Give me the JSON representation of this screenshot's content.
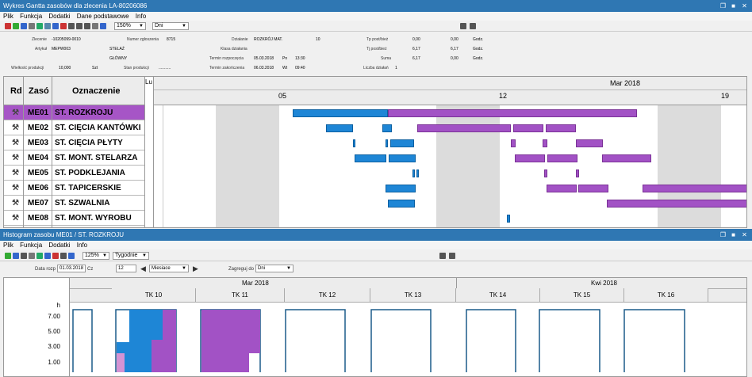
{
  "window": {
    "title": "Wykres Gantta zasobów dla zlecenia  LA-80206086"
  },
  "menu": [
    "Plik",
    "Funkcja",
    "Dodatki",
    "Dane podstawowe",
    "Info"
  ],
  "toolbar": {
    "zoom": "150%",
    "unit": "Dni"
  },
  "order": {
    "zlecenie_label": "Zlecenie",
    "zlecenie": "-10205099-0010",
    "artykul_label": "Artykuł",
    "artykul": "MEPW003",
    "nazwa1": "STELAŻ",
    "nazwa2": "GŁÓWNY",
    "numer_label": "Numer zgłoszenia",
    "numer": "8715",
    "dzialanie_label": "Działanie",
    "dzialanie": "ROZKRÓJ MAT.",
    "dzialanie_nr": "10",
    "klasa_label": "Klasa działania",
    "termin_roz_label": "Termin rozpoczęcia",
    "termin_roz": "05.03.2018",
    "termin_roz_day": "Pn",
    "termin_roz_time": "13:30",
    "termin_zak_label": "Termin zakończenia",
    "termin_zak": "06.03.2018",
    "termin_zak_day": "Wt",
    "termin_zak_time": "09:40",
    "tp_label": "Tp post/bież",
    "tp1": "0,00",
    "tp2": "0,00",
    "tp_unit": "Godz.",
    "tj_label": "Tj post/bież",
    "tj1": "6,17",
    "tj2": "6,17",
    "tj_unit": "Godz.",
    "suma_label": "Suma",
    "suma1": "6,17",
    "suma2": "0,00",
    "suma_unit": "Godz.",
    "liczba_label": "Liczba działań",
    "liczba": "1",
    "wielkosc_label": "Wielkość produkcji",
    "wielkosc": "10,000",
    "wielkosc_unit": "Szt",
    "stan_label": "Stan produkcji",
    "stan": "..........."
  },
  "gantt": {
    "headers": {
      "rd": "Rd",
      "zaso": "Zasó",
      "oznaczenie": "Oznaczenie",
      "lu": "Lu"
    },
    "month": "Mar 2018",
    "days": [
      "05",
      "12",
      "19"
    ],
    "rows": [
      {
        "code": "ME01",
        "name": "ST. ROZKROJU"
      },
      {
        "code": "ME02",
        "name": "ST. CIĘCIA KANTÓWKI"
      },
      {
        "code": "ME03",
        "name": "ST. CIĘCIA PŁYTY"
      },
      {
        "code": "ME04",
        "name": "ST. MONT. STELARZA"
      },
      {
        "code": "ME05",
        "name": "ST. PODKLEJANIA"
      },
      {
        "code": "ME06",
        "name": "ST. TAPICERSKIE"
      },
      {
        "code": "ME07",
        "name": "ST. SZWALNIA"
      },
      {
        "code": "ME08",
        "name": "ST. MONT. WYROBU"
      }
    ]
  },
  "histogram": {
    "title": "Histogram zasobu ME01 / ST. ROZKROJU",
    "menu": [
      "Plik",
      "Funkcja",
      "Dodatki",
      "Info"
    ],
    "zoom": "125%",
    "unit": "Tygodnie",
    "data_label": "Data rozp",
    "data": "01.03.2018",
    "data_day": "Cz",
    "count": "12",
    "period": "Miesiace",
    "agg_label": "Zagreguj do",
    "agg": "Dni",
    "months": [
      "Mar 2018",
      "Kwi 2018"
    ],
    "weeks": [
      "TK 10",
      "TK 11",
      "TK 12",
      "TK 13",
      "TK 14",
      "TK 15",
      "TK 16"
    ],
    "y_unit": "h",
    "y_ticks": [
      "7.00",
      "5.00",
      "3.00",
      "1.00"
    ]
  }
}
